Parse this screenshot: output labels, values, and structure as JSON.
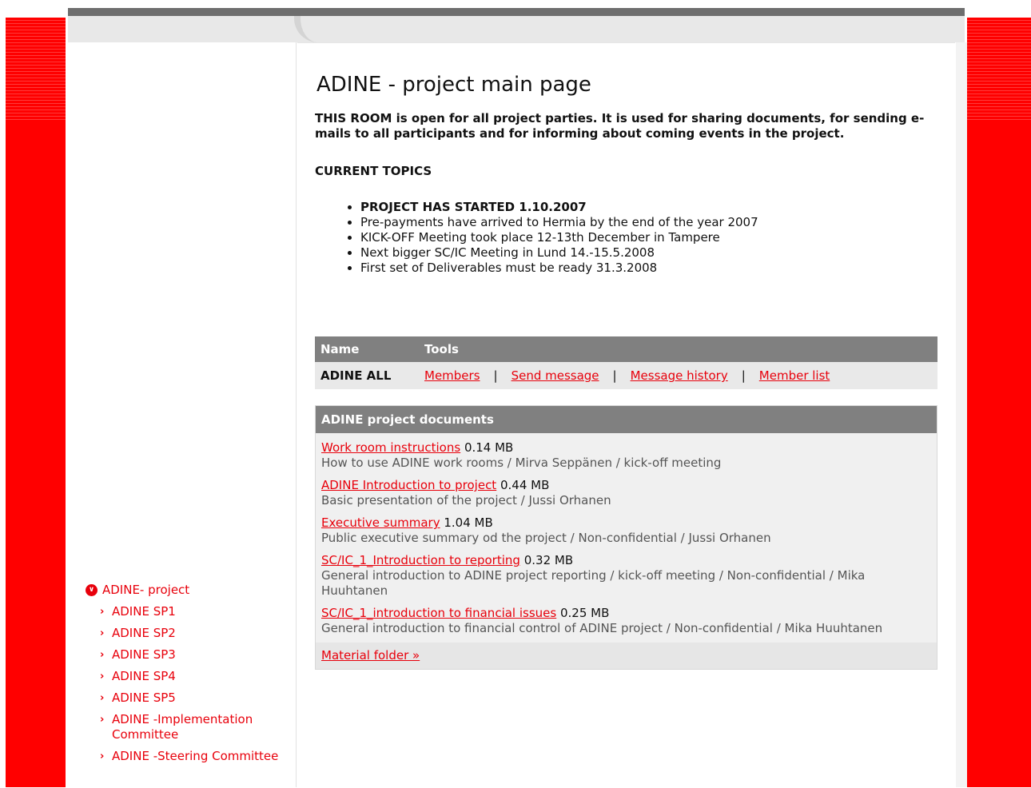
{
  "colors": {
    "accent_red": "#ff0000",
    "link_red": "#e8000b",
    "header_gray": "#808080"
  },
  "page": {
    "title": "ADINE - project main page",
    "intro": "THIS ROOM is open for all project parties. It is used for sharing documents, for sending e-mails to all participants and for informing about coming events in the project.",
    "topics_heading": "CURRENT TOPICS",
    "topics": [
      "PROJECT HAS STARTED 1.10.2007",
      "Pre-payments have arrived to Hermia by the end of the year 2007",
      "KICK-OFF Meeting took place 12-13th December in Tampere",
      "Next bigger SC/IC Meeting in Lund 14.-15.5.2008",
      "First set of Deliverables must be ready 31.3.2008"
    ]
  },
  "nav": {
    "parent_icon": "chevron-down-circle-icon",
    "parent": "ADINE- project",
    "item_icon": "chevron-right-icon",
    "items": [
      "ADINE SP1",
      "ADINE SP2",
      "ADINE SP3",
      "ADINE SP4",
      "ADINE SP5",
      "ADINE -Implementation Committee",
      "ADINE -Steering Committee"
    ]
  },
  "tools": {
    "header_name": "Name",
    "header_tools": "Tools",
    "group": "ADINE ALL",
    "links": [
      "Members",
      "Send message",
      "Message history",
      "Member list"
    ],
    "separator": "|"
  },
  "documents": {
    "heading": "ADINE project documents",
    "items": [
      {
        "name": "Work room instructions",
        "size": "0.14 MB",
        "desc": "How to use ADINE work rooms / Mirva Seppänen / kick-off meeting"
      },
      {
        "name": "ADINE Introduction to project",
        "size": "0.44 MB",
        "desc": "Basic presentation of the project / Jussi Orhanen"
      },
      {
        "name": "Executive summary",
        "size": "1.04 MB",
        "desc": "Public executive summary od the project / Non-confidential / Jussi Orhanen"
      },
      {
        "name": "SC/IC_1_Introduction to reporting",
        "size": "0.32 MB",
        "desc": "General introduction to ADINE project reporting / kick-off meeting / Non-confidential / Mika Huuhtanen"
      },
      {
        "name": "SC/IC_1_introduction to financial issues",
        "size": "0.25 MB",
        "desc": "General introduction to financial control of ADINE project / Non-confidential / Mika Huuhtanen"
      }
    ],
    "folder_link": "Material folder »"
  }
}
